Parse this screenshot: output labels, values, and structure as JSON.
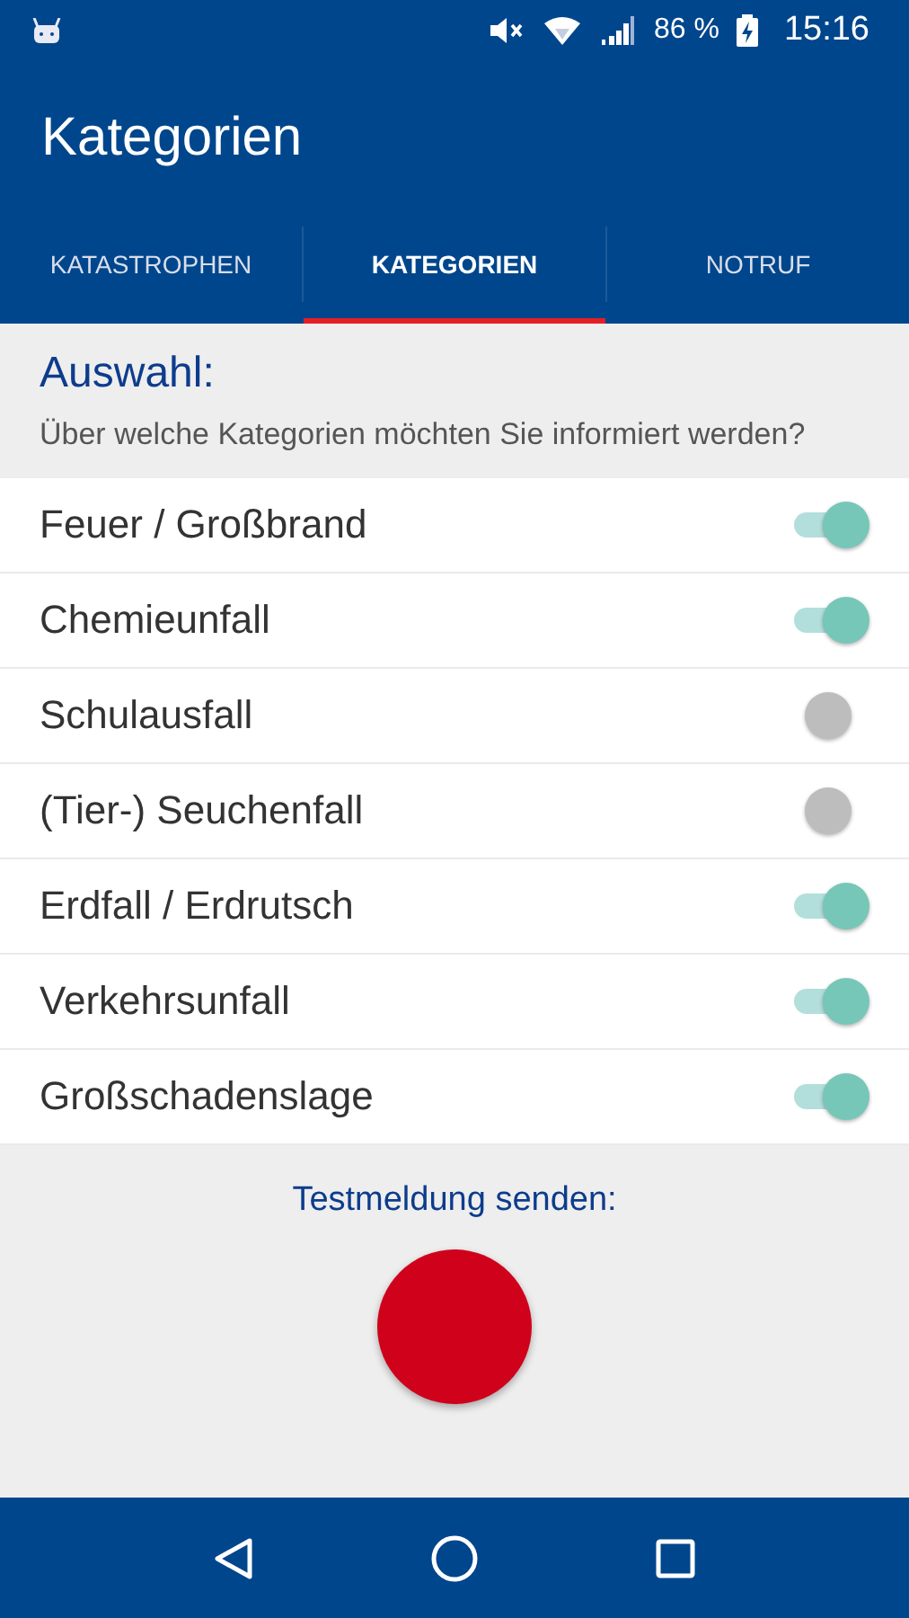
{
  "status_bar": {
    "battery": "86 %",
    "time": "15:16"
  },
  "app_bar": {
    "title": "Kategorien"
  },
  "tabs": [
    {
      "label": "KATASTROPHEN",
      "selected": false
    },
    {
      "label": "KATEGORIEN",
      "selected": true
    },
    {
      "label": "NOTRUF",
      "selected": false
    }
  ],
  "section": {
    "heading": "Auswahl:",
    "description": "Über welche Kategorien möchten Sie informiert werden?"
  },
  "categories": [
    {
      "label": "Feuer / Großbrand",
      "on": true
    },
    {
      "label": "Chemieunfall",
      "on": true
    },
    {
      "label": "Schulausfall",
      "on": false
    },
    {
      "label": "(Tier-) Seuchenfall",
      "on": false
    },
    {
      "label": "Erdfall / Erdrutsch",
      "on": true
    },
    {
      "label": "Verkehrsunfall",
      "on": true
    },
    {
      "label": "Großschadenslage",
      "on": true
    }
  ],
  "test": {
    "label": "Testmeldung senden:"
  }
}
